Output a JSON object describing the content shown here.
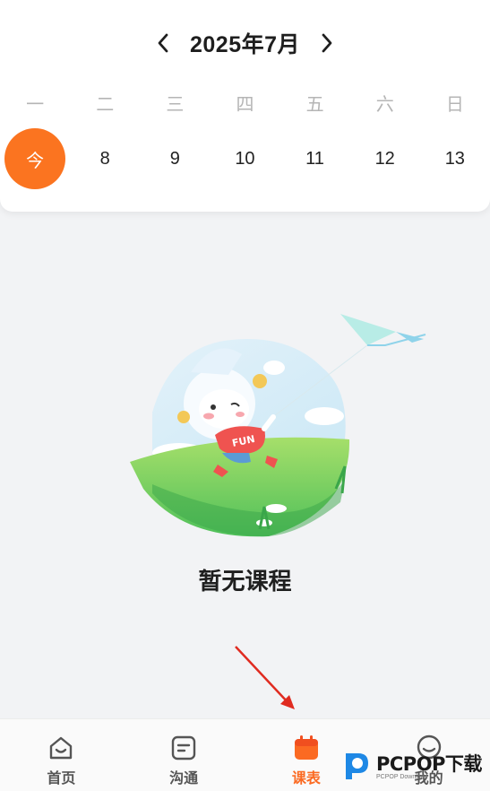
{
  "calendar": {
    "month_title": "2025年7月",
    "weekdays": [
      "一",
      "二",
      "三",
      "四",
      "五",
      "六",
      "日"
    ],
    "days": [
      "今",
      "8",
      "9",
      "10",
      "11",
      "12",
      "13"
    ],
    "today_color": "#fb7420"
  },
  "empty_state": {
    "message": "暂无课程",
    "shirt_text": "FUN"
  },
  "tabbar": {
    "tabs": [
      {
        "label": "首页",
        "icon": "home-icon"
      },
      {
        "label": "沟通",
        "icon": "chat-icon"
      },
      {
        "label": "课表",
        "icon": "calendar-icon",
        "active": true
      },
      {
        "label": "我的",
        "icon": "profile-icon"
      }
    ],
    "active_color": "#fb6a22"
  },
  "watermark": {
    "brand": "PCPOP下载",
    "sub": "PCPOP Download"
  }
}
